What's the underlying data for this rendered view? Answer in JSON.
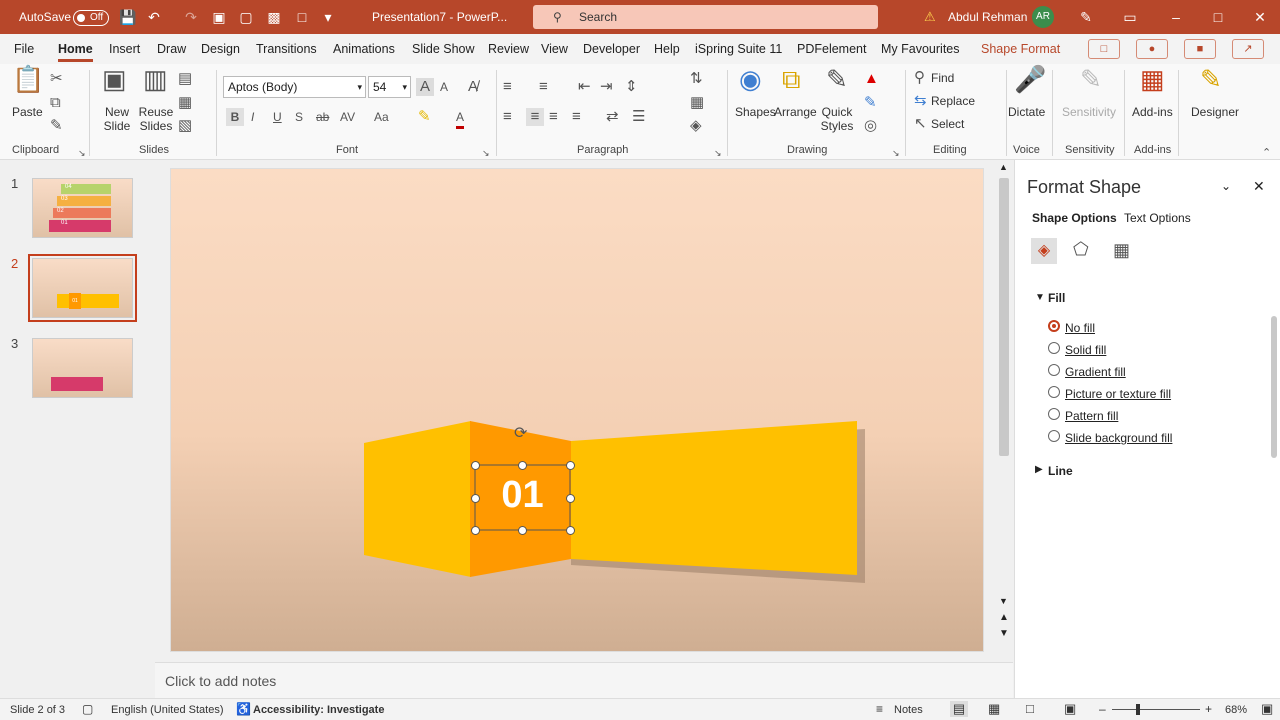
{
  "titlebar": {
    "autosave_label": "AutoSave",
    "autosave_state": "Off",
    "doc_title": "Presentation7 - PowerP...",
    "search_placeholder": "Search",
    "user_name": "Abdul Rehman",
    "user_initials": "AR"
  },
  "menu": {
    "tabs": [
      "File",
      "Home",
      "Insert",
      "Draw",
      "Design",
      "Transitions",
      "Animations",
      "Slide Show",
      "Review",
      "View",
      "Developer",
      "Help",
      "iSpring Suite 11",
      "PDFelement",
      "My Favourites",
      "Shape Format"
    ],
    "active": "Home"
  },
  "ribbon": {
    "clipboard": {
      "paste": "Paste",
      "group": "Clipboard"
    },
    "slides": {
      "new_slide": "New Slide",
      "reuse_slides": "Reuse Slides",
      "group": "Slides"
    },
    "font": {
      "font_name": "Aptos (Body)",
      "font_size": "54",
      "group": "Font"
    },
    "paragraph": {
      "group": "Paragraph"
    },
    "drawing": {
      "shapes": "Shapes",
      "arrange": "Arrange",
      "quick_styles": "Quick Styles",
      "group": "Drawing"
    },
    "editing": {
      "find": "Find",
      "replace": "Replace",
      "select": "Select",
      "group": "Editing"
    },
    "voice": {
      "dictate": "Dictate",
      "group": "Voice"
    },
    "sensitivity": {
      "label": "Sensitivity",
      "group": "Sensitivity"
    },
    "addins": {
      "label": "Add-ins",
      "group": "Add-ins"
    },
    "designer": {
      "label": "Designer"
    }
  },
  "thumbnails": [
    {
      "num": "1",
      "labels": [
        "04",
        "03",
        "02",
        "01"
      ]
    },
    {
      "num": "2",
      "labels": [
        "01"
      ]
    },
    {
      "num": "3",
      "labels": []
    }
  ],
  "slide": {
    "number_text": "01"
  },
  "notes_placeholder": "Click to add notes",
  "format_pane": {
    "title": "Format Shape",
    "tab_shape": "Shape Options",
    "tab_text": "Text Options",
    "fill_section": "Fill",
    "fill_options": [
      "No fill",
      "Solid fill",
      "Gradient fill",
      "Picture or texture fill",
      "Pattern fill",
      "Slide background fill"
    ],
    "selected_fill": "No fill",
    "line_section": "Line"
  },
  "status": {
    "slide": "Slide 2 of 3",
    "language": "English (United States)",
    "accessibility": "Accessibility: Investigate",
    "notes": "Notes",
    "zoom": "68%"
  },
  "colors": {
    "accent": "#b7472a",
    "shape_yellow": "#ffc000",
    "shape_orange": "#ff9900"
  }
}
